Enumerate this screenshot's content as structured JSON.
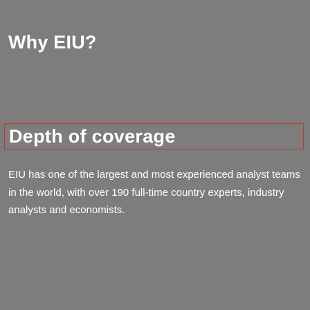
{
  "page": {
    "title": "Why EIU?"
  },
  "section": {
    "title": "Depth of coverage",
    "description": "EIU has one of the largest and most experienced analyst teams in the world, with over 190 full-time country experts, industry analysts and economists.",
    "border_color": "#c0392b"
  },
  "colors": {
    "background": "#7d7d7d",
    "text": "#ffffff"
  }
}
